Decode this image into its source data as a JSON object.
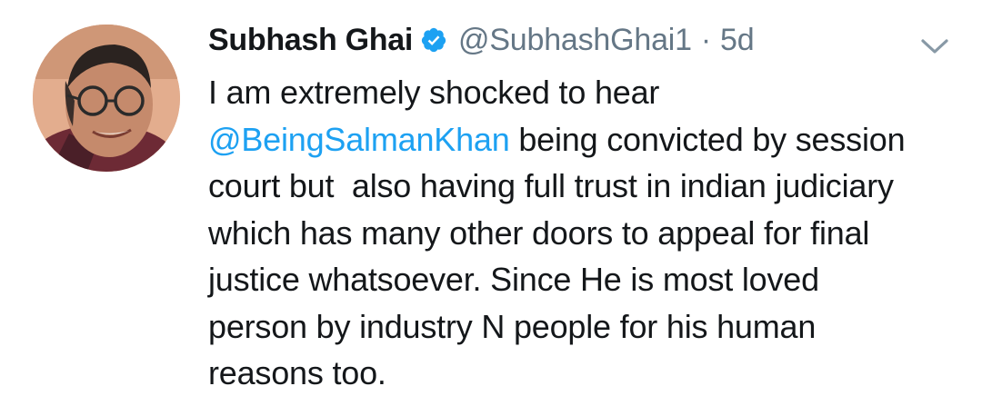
{
  "author": {
    "name": "Subhash Ghai",
    "handle": "@SubhashGhai1",
    "separator": "·",
    "timestamp": "5d",
    "verified": true
  },
  "icons": {
    "verified": "verified-badge-icon",
    "menu": "chevron-down-icon"
  },
  "colors": {
    "link": "#1da1f2",
    "muted": "#657786",
    "text": "#14171a",
    "background": "#ffffff"
  },
  "tweet": {
    "line1": "I am extremely shocked to hear",
    "mention": "@BeingSalmanKhan",
    "line2_rest": " being convicted by session",
    "line3": "court but  also having full trust in indian judiciary",
    "line4": "which has many other doors to appeal for final",
    "line5": "justice whatsoever. Since He is most loved",
    "line6": "person by industry N people for his human",
    "line7": "reasons too."
  }
}
